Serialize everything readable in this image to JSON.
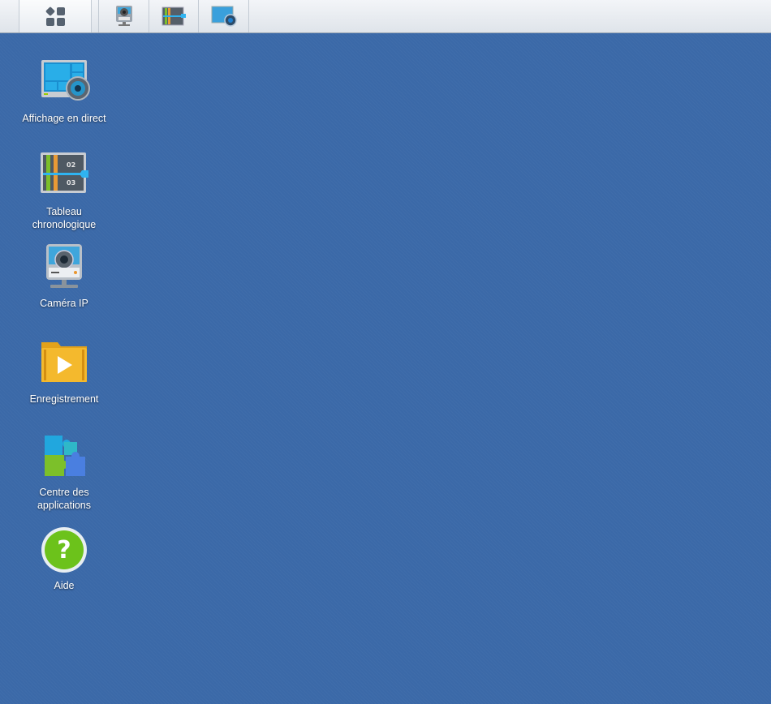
{
  "taskbar": {
    "buttons": [
      {
        "name": "main-menu",
        "icon": "grid-icon"
      },
      {
        "name": "ip-camera",
        "icon": "ip-camera-icon"
      },
      {
        "name": "timeline",
        "icon": "timeline-icon"
      },
      {
        "name": "live-view",
        "icon": "live-view-icon"
      }
    ]
  },
  "desktop": {
    "icons": [
      {
        "label": "Affichage en direct",
        "icon": "live-view-icon"
      },
      {
        "label": "Tableau chronologique",
        "icon": "timeline-icon",
        "tick1": "02",
        "tick2": "03"
      },
      {
        "label": "Caméra IP",
        "icon": "ip-camera-icon"
      },
      {
        "label": "Enregistrement",
        "icon": "recording-folder-icon"
      },
      {
        "label": "Centre des applications",
        "icon": "puzzle-icon"
      },
      {
        "label": "Aide",
        "icon": "help-icon"
      }
    ]
  },
  "colors": {
    "desktop": "#3b69a8",
    "taskbar": "#e8ecf1"
  }
}
